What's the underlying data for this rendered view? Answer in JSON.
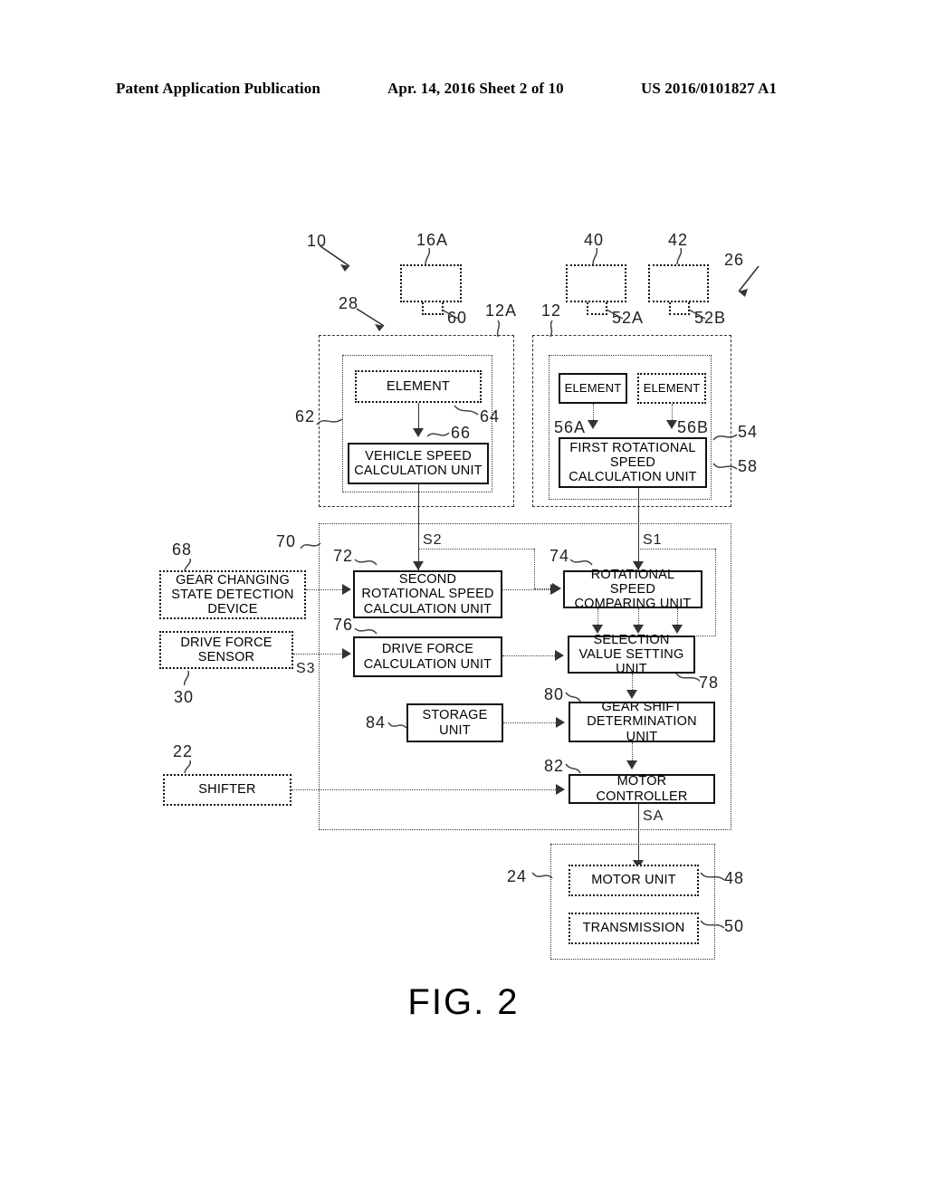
{
  "header": {
    "left": "Patent Application Publication",
    "center": "Apr. 14, 2016  Sheet 2 of 10",
    "right": "US 2016/0101827 A1"
  },
  "figure": {
    "caption": "FIG. 2"
  },
  "boxes": {
    "element_left": "ELEMENT",
    "element_r1": "ELEMENT",
    "element_r2": "ELEMENT",
    "vehicle_speed": "VEHICLE SPEED CALCULATION UNIT",
    "first_rot_speed": "FIRST ROTATIONAL SPEED CALCULATION UNIT",
    "gear_changing": "GEAR CHANGING STATE DETECTION DEVICE",
    "drive_force_sensor": "DRIVE FORCE SENSOR",
    "second_rot_speed": "SECOND ROTATIONAL SPEED CALCULATION UNIT",
    "rot_speed_comparing": "ROTATIONAL SPEED COMPARING UNIT",
    "drive_force_calc": "DRIVE FORCE CALCULATION UNIT",
    "selection_value": "SELECTION VALUE SETTING UNIT",
    "storage_unit": "STORAGE UNIT",
    "gear_shift_det": "GEAR SHIFT DETERMINATION UNIT",
    "motor_controller": "MOTOR CONTROLLER",
    "shifter": "SHIFTER",
    "motor_unit": "MOTOR UNIT",
    "transmission": "TRANSMISSION"
  },
  "refs": {
    "r10": "10",
    "r16A": "16A",
    "r40": "40",
    "r42": "42",
    "r26": "26",
    "r28": "28",
    "r60": "60",
    "r12A": "12A",
    "r12": "12",
    "r52A": "52A",
    "r52B": "52B",
    "r62": "62",
    "r64": "64",
    "r66": "66",
    "r56A": "56A",
    "r56B": "56B",
    "r54": "54",
    "r58": "58",
    "r68": "68",
    "r70": "70",
    "r72": "72",
    "r74": "74",
    "r76": "76",
    "r78": "78",
    "r80": "80",
    "r82": "82",
    "r84": "84",
    "r30": "30",
    "r22": "22",
    "r24": "24",
    "r48": "48",
    "r50": "50"
  },
  "signals": {
    "s1": "S1",
    "s2": "S2",
    "s3": "S3",
    "sa": "SA"
  }
}
